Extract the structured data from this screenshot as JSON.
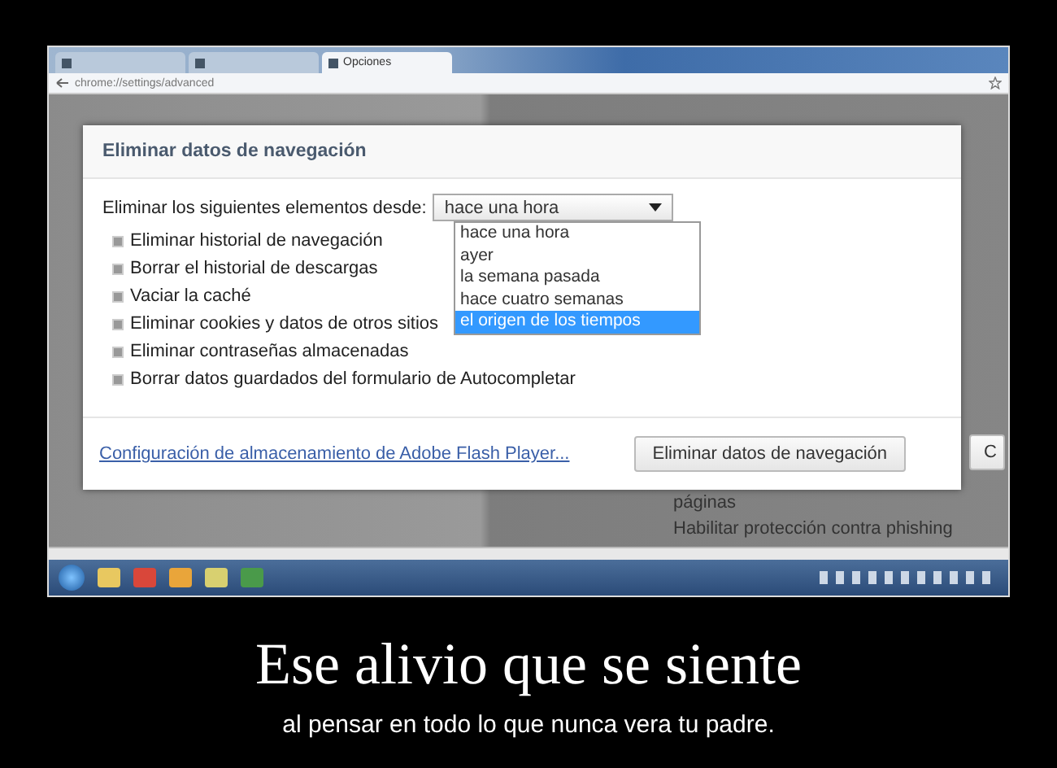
{
  "browser": {
    "tabs": [
      {
        "selected": false
      },
      {
        "selected": false
      },
      {
        "label": "Opciones",
        "selected": true
      }
    ],
    "address": "chrome://settings/advanced"
  },
  "background_page": {
    "lines": [
      "páginas",
      "Habilitar protección contra phishing"
    ]
  },
  "dialog": {
    "title": "Eliminar datos de navegación",
    "range_label": "Eliminar los siguientes elementos desde:",
    "range_value": "hace una hora",
    "range_options": [
      {
        "label": "hace una hora",
        "selected": false
      },
      {
        "label": "ayer",
        "selected": false
      },
      {
        "label": "la semana pasada",
        "selected": false
      },
      {
        "label": "hace cuatro semanas",
        "selected": false
      },
      {
        "label": "el origen de los tiempos",
        "selected": true
      }
    ],
    "items": [
      {
        "label": "Eliminar historial de navegación",
        "checked": true
      },
      {
        "label": "Borrar el historial de descargas",
        "checked": true
      },
      {
        "label": "Vaciar la caché",
        "checked": true
      },
      {
        "label": "Eliminar cookies y datos de otros sitios",
        "checked": true
      },
      {
        "label": "Eliminar contraseñas almacenadas",
        "checked": true
      },
      {
        "label": "Borrar datos guardados del formulario de Autocompletar",
        "checked": true
      }
    ],
    "flash_link": "Configuración de almacenamiento de Adobe Flash Player...",
    "confirm_button": "Eliminar datos de navegación",
    "cancel_button": "C"
  },
  "caption": {
    "title": "Ese alivio que se siente",
    "subtitle": "al pensar en todo lo que nunca vera tu padre."
  }
}
